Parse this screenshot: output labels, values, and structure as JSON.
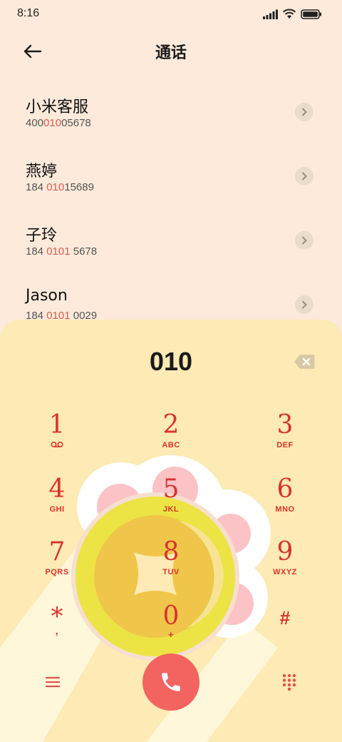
{
  "status_bar": {
    "time": "8:16"
  },
  "header": {
    "title": "通话"
  },
  "contacts": [
    {
      "name": "小米客服",
      "number_pre": "400",
      "number_hl": "010",
      "number_post": "05678"
    },
    {
      "name": "燕婷",
      "number_pre": "184 ",
      "number_hl": "010",
      "number_post": "15689"
    },
    {
      "name": "子玲",
      "number_pre": "184 ",
      "number_hl": "0101",
      "number_post": " 5678"
    },
    {
      "name": "Jason",
      "number_pre": "184 ",
      "number_hl": "0101",
      "number_post": " 0029"
    }
  ],
  "dialer": {
    "input": "010",
    "keys": [
      {
        "digit": "1",
        "letters": ""
      },
      {
        "digit": "2",
        "letters": "ABC"
      },
      {
        "digit": "3",
        "letters": "DEF"
      },
      {
        "digit": "4",
        "letters": "GHI"
      },
      {
        "digit": "5",
        "letters": "JKL"
      },
      {
        "digit": "6",
        "letters": "MNO"
      },
      {
        "digit": "7",
        "letters": "PQRS"
      },
      {
        "digit": "8",
        "letters": "TUV"
      },
      {
        "digit": "9",
        "letters": "WXYZ"
      },
      {
        "digit": "*",
        "letters": ","
      },
      {
        "digit": "0",
        "letters": "+"
      },
      {
        "digit": "#",
        "letters": ""
      }
    ]
  },
  "colors": {
    "accent": "#d9322d",
    "highlight": "#e25a4f",
    "call_button": "#f36360",
    "panel": "#fdeab4",
    "background": "#fdeadb"
  },
  "icons": {
    "back": "arrow-left-icon",
    "chevron": "chevron-right-icon",
    "backspace": "backspace-icon",
    "voicemail": "voicemail-icon",
    "menu": "menu-icon",
    "call": "phone-icon",
    "dialpad": "dialpad-icon"
  }
}
